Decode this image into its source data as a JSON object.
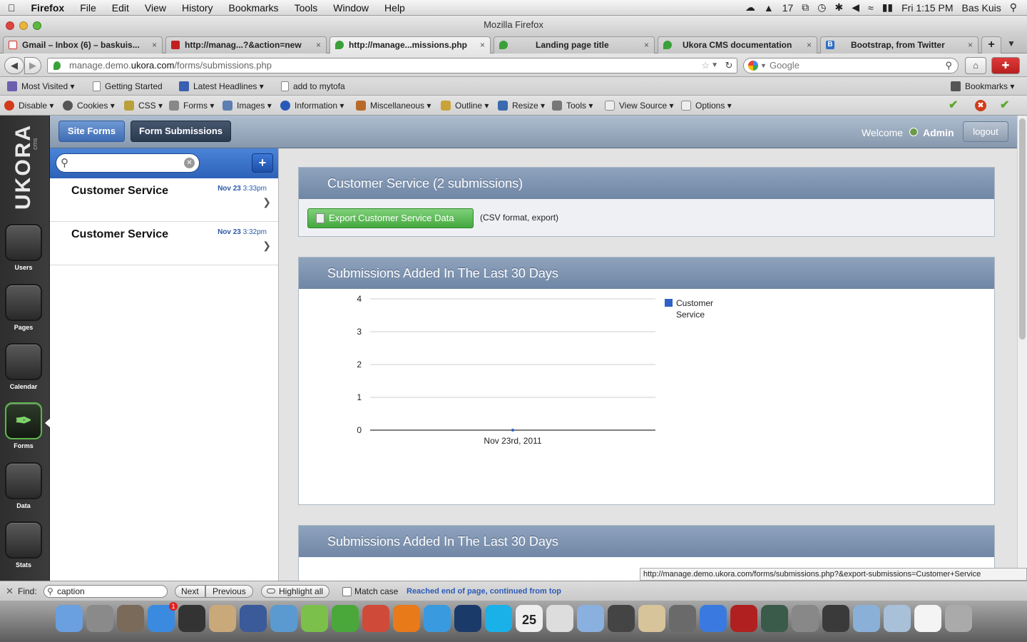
{
  "menubar": {
    "app": "Firefox",
    "items": [
      "File",
      "Edit",
      "View",
      "History",
      "Bookmarks",
      "Tools",
      "Window",
      "Help"
    ],
    "badge_count": "17",
    "clock": "Fri 1:15 PM",
    "user": "Bas Kuis"
  },
  "window_title": "Mozilla Firefox",
  "tabs": [
    {
      "label": "Gmail – Inbox (6) – baskuis...",
      "color": "#d93025"
    },
    {
      "label": "http://manag...?&action=new",
      "color": "#c22020"
    },
    {
      "label": "http://manage...missions.php",
      "color": "#3aa03a"
    },
    {
      "label": "Landing page title",
      "color": "#3aa03a"
    },
    {
      "label": "Ukora CMS documentation",
      "color": "#3aa03a"
    },
    {
      "label": "Bootstrap, from Twitter",
      "color": "#2f6fc7"
    }
  ],
  "url": {
    "prefix": "manage.demo.",
    "domain": "ukora.com",
    "path": "/forms/submissions.php"
  },
  "search_engine": "Google",
  "bookmarks": [
    "Most Visited",
    "Getting Started",
    "Latest Headlines",
    "add to mytofa"
  ],
  "bookmarks_menu": "Bookmarks",
  "devtoolbar": [
    "Disable",
    "Cookies",
    "CSS",
    "Forms",
    "Images",
    "Information",
    "Miscellaneous",
    "Outline",
    "Resize",
    "Tools",
    "View Source",
    "Options"
  ],
  "rail": [
    {
      "label": "Users"
    },
    {
      "label": "Pages"
    },
    {
      "label": "Calendar"
    },
    {
      "label": "Forms"
    },
    {
      "label": "Data"
    },
    {
      "label": "Stats"
    }
  ],
  "logo": "UKORA",
  "logo_sub": "cms",
  "header": {
    "tab_site_forms": "Site Forms",
    "tab_form_submissions": "Form Submissions",
    "welcome": "Welcome",
    "user": "Admin",
    "logout": "logout"
  },
  "list": {
    "add_label": "+",
    "items": [
      {
        "title": "Customer Service",
        "date": "Nov 23",
        "time": "3:33pm"
      },
      {
        "title": "Customer Service",
        "date": "Nov 23",
        "time": "3:32pm"
      }
    ]
  },
  "panels": {
    "service_title": "Customer Service (2 submissions)",
    "export_label": "Export Customer Service Data",
    "export_note": "(CSV format, export)",
    "chart_title": "Submissions Added In The Last 30 Days",
    "chart2_title": "Submissions Added In The Last 30 Days"
  },
  "chart_data": {
    "type": "line",
    "x": [
      "Nov 23rd, 2011"
    ],
    "series": [
      {
        "name": "Customer Service",
        "values": [
          0
        ],
        "color": "#2f62c8"
      }
    ],
    "ylim": [
      0,
      4
    ],
    "yticks": [
      "0",
      "1",
      "2",
      "3",
      "4"
    ],
    "grid": true,
    "legend": "right"
  },
  "statusbar": "http://manage.demo.ukora.com/forms/submissions.php?&export-submissions=Customer+Service",
  "findbar": {
    "label": "Find:",
    "value": "caption",
    "next": "Next",
    "previous": "Previous",
    "highlight": "Highlight all",
    "match_case": "Match case",
    "message": "Reached end of page, continued from top"
  },
  "dock": {
    "calendar_date": "25",
    "appstore_badge": "1",
    "icons": [
      "finder-icon",
      "launchpad-icon",
      "app-icon",
      "appstore-icon",
      "dashboard-icon",
      "preview-icon",
      "virtualbox-icon",
      "mail-icon",
      "adium-icon",
      "leaf-icon",
      "chrome-icon",
      "firefox-icon",
      "safari-icon",
      "photoshop-icon",
      "skype-icon",
      "ical-icon",
      "tool-icon",
      "chat-icon",
      "facetime-icon",
      "contacts-icon",
      "photo-icon",
      "itunes-icon",
      "photobooth-icon",
      "timemachine-icon",
      "systemprefs-icon",
      "spotify-icon",
      "applications-icon",
      "documents-icon",
      "file-icon",
      "trash-icon"
    ]
  }
}
